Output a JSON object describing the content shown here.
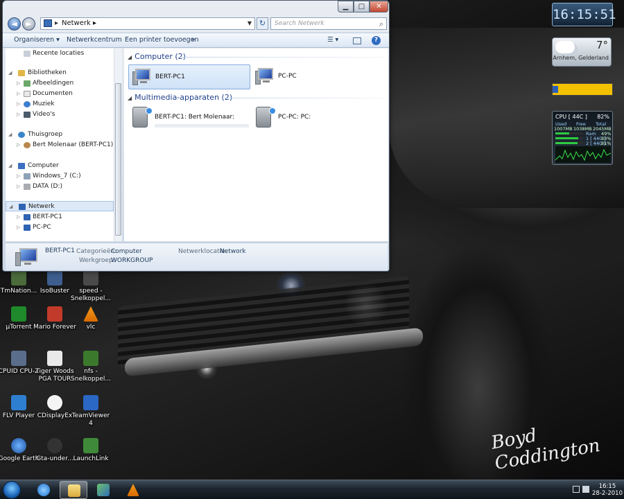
{
  "explorer": {
    "address_segment": "Netwerk",
    "search_placeholder": "Search Netwerk",
    "toolbar": {
      "organize": "Organiseren",
      "network_center": "Netwerkcentrum",
      "add_printer": "Een printer toevoegen",
      "more": "»"
    },
    "nav": {
      "recent": "Recente locaties",
      "libraries": "Bibliotheken",
      "pictures": "Afbeeldingen",
      "documents": "Documenten",
      "music": "Muziek",
      "videos": "Video's",
      "homegroup": "Thuisgroep",
      "homegroup_user": "Bert Molenaar (BERT-PC1)",
      "computer": "Computer",
      "drive_c": "Windows_7 (C:)",
      "drive_d": "DATA (D:)",
      "network": "Netwerk",
      "pc1": "BERT-PC1",
      "pc2": "PC-PC"
    },
    "groups": {
      "computer_header": "Computer (2)",
      "media_header": "Multimedia-apparaten (2)"
    },
    "items": {
      "pc1": "BERT-PC1",
      "pc2": "PC-PC",
      "media1": "BERT-PC1: Bert Molenaar:",
      "media2": "PC-PC: PC:"
    },
    "details": {
      "name": "BERT-PC1",
      "categories_key": "Categorieën:",
      "categories_val": "Computer",
      "workgroup_key": "Werkgroep:",
      "workgroup_val": "WORKGROUP",
      "netloc_key": "Netwerklocatie:",
      "netloc_val": "Network"
    }
  },
  "desktop_icons": {
    "tmnation": "TmNation...",
    "isobuster": "IsoBuster",
    "speed": "speed - Snelkoppel...",
    "utorrent": "µTorrent",
    "mario": "Mario Forever",
    "vlc": "vlc",
    "cpuid": "CPUID CPU-Z",
    "tigerwoods": "Tiger Woods PGA TOUR",
    "nfs": "nfs - Snelkoppel...",
    "flvplayer": "FLV Player",
    "cdisplayex": "CDisplayEx",
    "teamviewer": "TeamViewer 4",
    "googleearth": "Google Earth",
    "gta": "Gta-under...",
    "launchlink": "LaunchLink"
  },
  "gadgets": {
    "clock": "16:15:51",
    "weather_temp": "7°",
    "weather_location": "Arnhem, Gelderland",
    "cpu_title": "CPU [ 44C ]",
    "cpu_percent": "82%",
    "cpu_used_label": "Used",
    "cpu_free_label": "Free",
    "cpu_total_label": "Total",
    "cpu_used": "1007MB",
    "cpu_free": "1038MB",
    "cpu_total": "2045MB",
    "ram_label": "Ram",
    "ram_pct": "49%",
    "core1": "1 [ 44C ]",
    "core1_pct": "83%",
    "core2": "2 [ 44C ]",
    "core2_pct": "81%"
  },
  "taskbar": {
    "time": "16:15",
    "date": "28-2-2010"
  },
  "wallpaper": {
    "signature": "Boyd Coddington"
  }
}
